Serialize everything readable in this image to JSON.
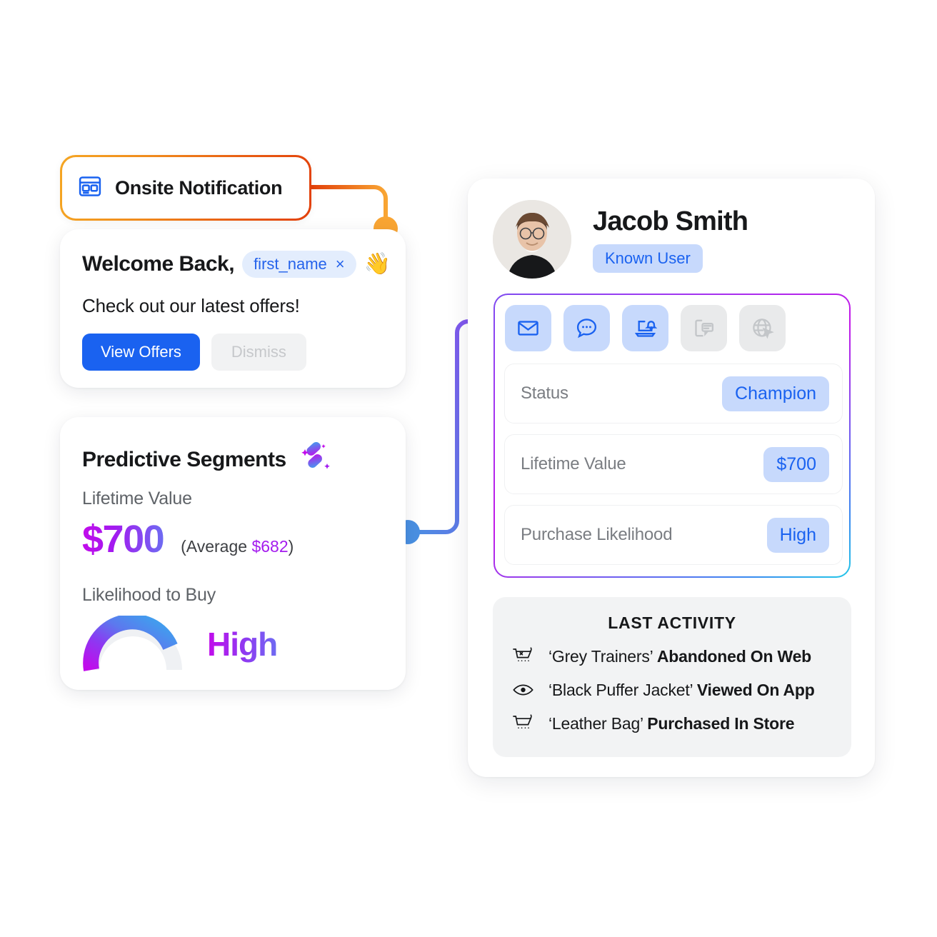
{
  "badge": {
    "label": "Onsite Notification",
    "icon": "onsite-window-icon",
    "border_gradient": [
      "#F5A623",
      "#E2400A"
    ]
  },
  "welcome_card": {
    "title": "Welcome Back,",
    "token": "first_name",
    "token_remove": "×",
    "emoji": "👋",
    "subtitle": "Check out our latest offers!",
    "primary_button": "View Offers",
    "secondary_button": "Dismiss",
    "primary_color": "#1A62F0"
  },
  "predictive": {
    "title": "Predictive Segments",
    "icon": "sparkle-segments-icon",
    "ltv_label": "Lifetime Value",
    "ltv_value": "$700",
    "ltv_average_prefix": "(Average ",
    "ltv_average_value": "$682",
    "ltv_average_suffix": ")",
    "likelihood_label": "Likelihood to Buy",
    "likelihood_value": "High",
    "gauge_percent": 88,
    "accent_gradient": [
      "#C20BEB",
      "#6E6BF2"
    ]
  },
  "profile": {
    "name": "Jacob Smith",
    "badge": "Known User",
    "channels": [
      {
        "name": "email-icon",
        "state": "active"
      },
      {
        "name": "in-app-message-icon",
        "state": "active"
      },
      {
        "name": "push-notification-icon",
        "state": "active"
      },
      {
        "name": "sms-icon",
        "state": "inactive"
      },
      {
        "name": "web-personalization-icon",
        "state": "inactive"
      }
    ],
    "stats": [
      {
        "label": "Status",
        "value": "Champion"
      },
      {
        "label": "Lifetime Value",
        "value": "$700"
      },
      {
        "label": "Purchase Likelihood",
        "value": "High"
      }
    ],
    "value_pill_bg": "#C7D9FC",
    "value_pill_text": "#1A62F0"
  },
  "activity": {
    "title": "LAST ACTIVITY",
    "items": [
      {
        "icon": "cart-abandoned-icon",
        "item": "‘Grey Trainers’ ",
        "action": "Abandoned On Web"
      },
      {
        "icon": "eye-icon",
        "item": "‘Black Puffer Jacket’ ",
        "action": "Viewed On App"
      },
      {
        "icon": "cart-icon",
        "item": "‘Leather Bag’ ",
        "action": "Purchased In Store"
      }
    ]
  },
  "connectors": {
    "orange_dot_color": "#F9A533",
    "blue_dot_color": "#4A90E2"
  }
}
